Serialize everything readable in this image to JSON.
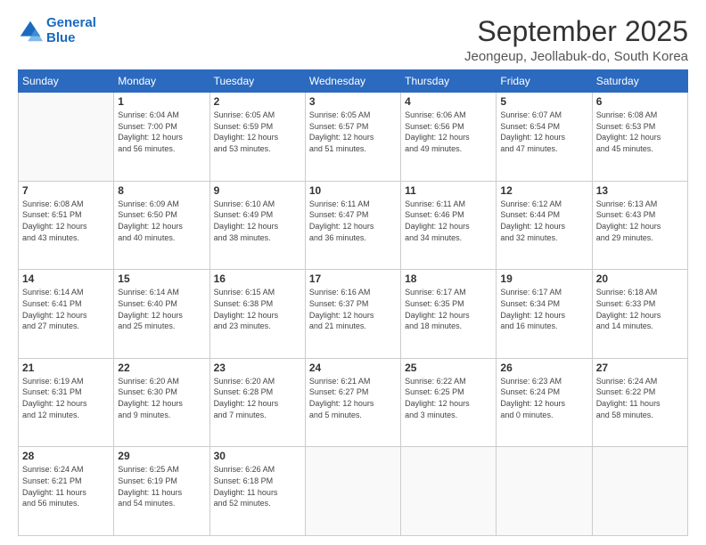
{
  "logo": {
    "line1": "General",
    "line2": "Blue"
  },
  "header": {
    "month": "September 2025",
    "location": "Jeongeup, Jeollabuk-do, South Korea"
  },
  "weekdays": [
    "Sunday",
    "Monday",
    "Tuesday",
    "Wednesday",
    "Thursday",
    "Friday",
    "Saturday"
  ],
  "weeks": [
    [
      {
        "day": "",
        "info": ""
      },
      {
        "day": "1",
        "info": "Sunrise: 6:04 AM\nSunset: 7:00 PM\nDaylight: 12 hours\nand 56 minutes."
      },
      {
        "day": "2",
        "info": "Sunrise: 6:05 AM\nSunset: 6:59 PM\nDaylight: 12 hours\nand 53 minutes."
      },
      {
        "day": "3",
        "info": "Sunrise: 6:05 AM\nSunset: 6:57 PM\nDaylight: 12 hours\nand 51 minutes."
      },
      {
        "day": "4",
        "info": "Sunrise: 6:06 AM\nSunset: 6:56 PM\nDaylight: 12 hours\nand 49 minutes."
      },
      {
        "day": "5",
        "info": "Sunrise: 6:07 AM\nSunset: 6:54 PM\nDaylight: 12 hours\nand 47 minutes."
      },
      {
        "day": "6",
        "info": "Sunrise: 6:08 AM\nSunset: 6:53 PM\nDaylight: 12 hours\nand 45 minutes."
      }
    ],
    [
      {
        "day": "7",
        "info": "Sunrise: 6:08 AM\nSunset: 6:51 PM\nDaylight: 12 hours\nand 43 minutes."
      },
      {
        "day": "8",
        "info": "Sunrise: 6:09 AM\nSunset: 6:50 PM\nDaylight: 12 hours\nand 40 minutes."
      },
      {
        "day": "9",
        "info": "Sunrise: 6:10 AM\nSunset: 6:49 PM\nDaylight: 12 hours\nand 38 minutes."
      },
      {
        "day": "10",
        "info": "Sunrise: 6:11 AM\nSunset: 6:47 PM\nDaylight: 12 hours\nand 36 minutes."
      },
      {
        "day": "11",
        "info": "Sunrise: 6:11 AM\nSunset: 6:46 PM\nDaylight: 12 hours\nand 34 minutes."
      },
      {
        "day": "12",
        "info": "Sunrise: 6:12 AM\nSunset: 6:44 PM\nDaylight: 12 hours\nand 32 minutes."
      },
      {
        "day": "13",
        "info": "Sunrise: 6:13 AM\nSunset: 6:43 PM\nDaylight: 12 hours\nand 29 minutes."
      }
    ],
    [
      {
        "day": "14",
        "info": "Sunrise: 6:14 AM\nSunset: 6:41 PM\nDaylight: 12 hours\nand 27 minutes."
      },
      {
        "day": "15",
        "info": "Sunrise: 6:14 AM\nSunset: 6:40 PM\nDaylight: 12 hours\nand 25 minutes."
      },
      {
        "day": "16",
        "info": "Sunrise: 6:15 AM\nSunset: 6:38 PM\nDaylight: 12 hours\nand 23 minutes."
      },
      {
        "day": "17",
        "info": "Sunrise: 6:16 AM\nSunset: 6:37 PM\nDaylight: 12 hours\nand 21 minutes."
      },
      {
        "day": "18",
        "info": "Sunrise: 6:17 AM\nSunset: 6:35 PM\nDaylight: 12 hours\nand 18 minutes."
      },
      {
        "day": "19",
        "info": "Sunrise: 6:17 AM\nSunset: 6:34 PM\nDaylight: 12 hours\nand 16 minutes."
      },
      {
        "day": "20",
        "info": "Sunrise: 6:18 AM\nSunset: 6:33 PM\nDaylight: 12 hours\nand 14 minutes."
      }
    ],
    [
      {
        "day": "21",
        "info": "Sunrise: 6:19 AM\nSunset: 6:31 PM\nDaylight: 12 hours\nand 12 minutes."
      },
      {
        "day": "22",
        "info": "Sunrise: 6:20 AM\nSunset: 6:30 PM\nDaylight: 12 hours\nand 9 minutes."
      },
      {
        "day": "23",
        "info": "Sunrise: 6:20 AM\nSunset: 6:28 PM\nDaylight: 12 hours\nand 7 minutes."
      },
      {
        "day": "24",
        "info": "Sunrise: 6:21 AM\nSunset: 6:27 PM\nDaylight: 12 hours\nand 5 minutes."
      },
      {
        "day": "25",
        "info": "Sunrise: 6:22 AM\nSunset: 6:25 PM\nDaylight: 12 hours\nand 3 minutes."
      },
      {
        "day": "26",
        "info": "Sunrise: 6:23 AM\nSunset: 6:24 PM\nDaylight: 12 hours\nand 0 minutes."
      },
      {
        "day": "27",
        "info": "Sunrise: 6:24 AM\nSunset: 6:22 PM\nDaylight: 11 hours\nand 58 minutes."
      }
    ],
    [
      {
        "day": "28",
        "info": "Sunrise: 6:24 AM\nSunset: 6:21 PM\nDaylight: 11 hours\nand 56 minutes."
      },
      {
        "day": "29",
        "info": "Sunrise: 6:25 AM\nSunset: 6:19 PM\nDaylight: 11 hours\nand 54 minutes."
      },
      {
        "day": "30",
        "info": "Sunrise: 6:26 AM\nSunset: 6:18 PM\nDaylight: 11 hours\nand 52 minutes."
      },
      {
        "day": "",
        "info": ""
      },
      {
        "day": "",
        "info": ""
      },
      {
        "day": "",
        "info": ""
      },
      {
        "day": "",
        "info": ""
      }
    ]
  ]
}
